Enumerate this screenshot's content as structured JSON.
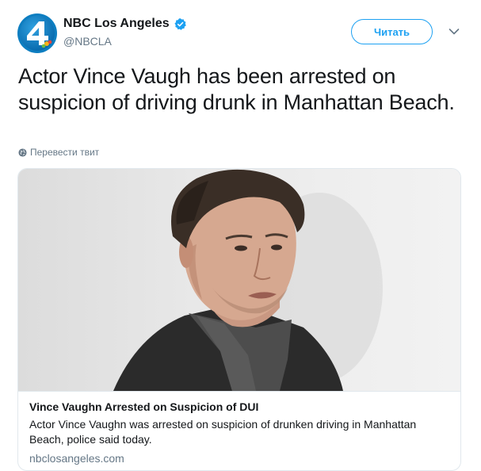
{
  "account": {
    "display_name": "NBC Los Angeles",
    "handle": "@NBCLA",
    "avatar_label": "4"
  },
  "follow_button": {
    "label": "Читать"
  },
  "tweet": {
    "text": "Actor Vince Vaugh has been arrested on suspicion of driving drunk in Manhattan Beach.",
    "translate_label": "Перевести твит"
  },
  "card": {
    "title": "Vince Vaughn Arrested on Suspicion of DUI",
    "description": "Actor Vince Vaughn was arrested on suspicion of drunken driving in Manhattan Beach, police said today.",
    "domain": "nbclosangeles.com"
  },
  "colors": {
    "accent": "#1da1f2",
    "text": "#14171a",
    "muted": "#657786",
    "border": "#e1e8ed",
    "avatar": "#0d7ec1"
  },
  "icons": {
    "verified": "verified-badge-icon",
    "caret": "chevron-down-icon",
    "globe": "globe-icon"
  }
}
